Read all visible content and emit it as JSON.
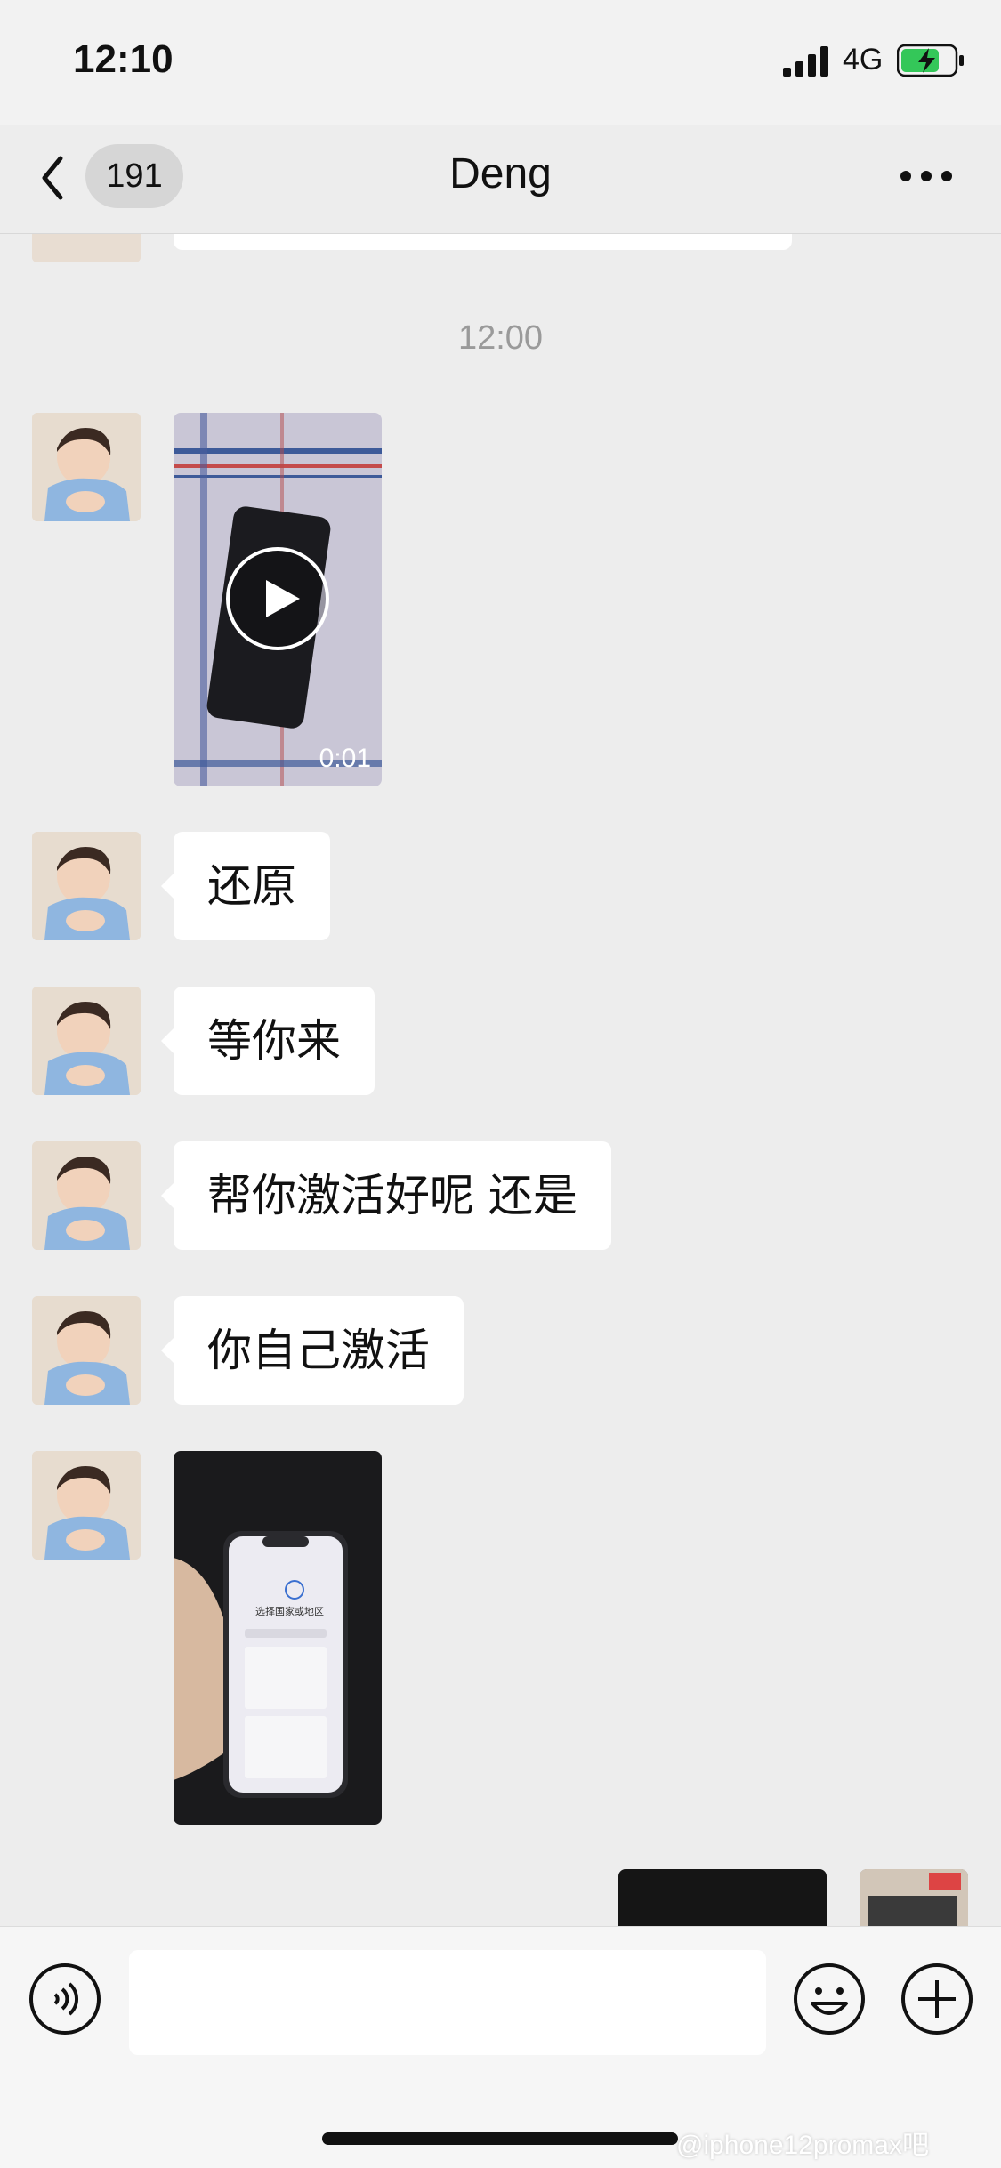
{
  "status_bar": {
    "time": "12:10",
    "network": "4G"
  },
  "nav": {
    "back_badge": "191",
    "title": "Deng"
  },
  "chat": {
    "timestamp": "12:00",
    "video": {
      "duration": "0:01"
    },
    "messages": [
      "还原",
      "等你来",
      "帮你激活好呢  还是",
      "你自己激活"
    ],
    "screenshot_text": {
      "heading": "选择国家或地区"
    }
  },
  "input": {
    "placeholder": ""
  },
  "watermark": "@iphone12promax吧",
  "icons": [
    "back-icon",
    "voice-icon",
    "emoji-icon",
    "plus-icon",
    "play-icon",
    "more-icon",
    "signal-icon",
    "battery-icon"
  ]
}
